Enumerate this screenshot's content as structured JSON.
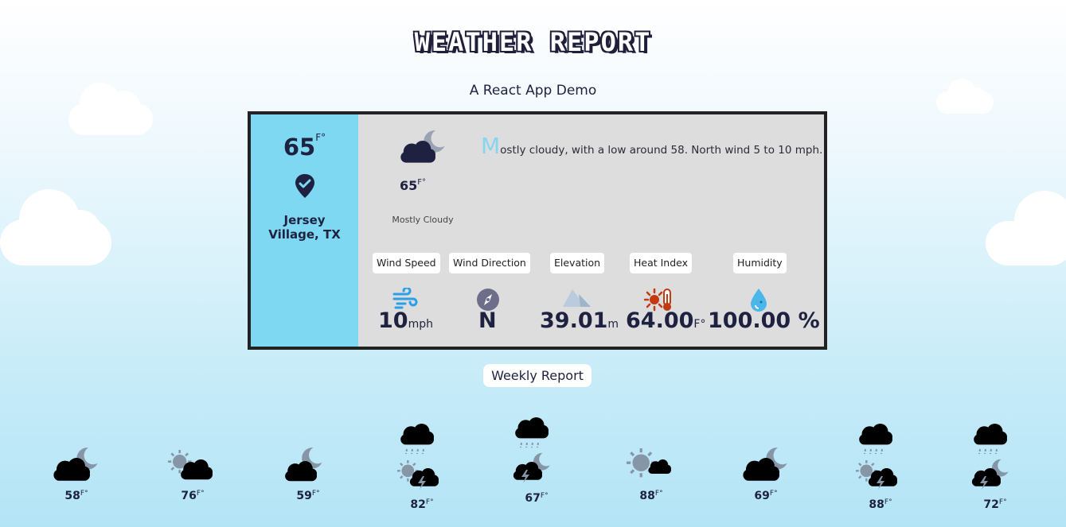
{
  "title": "WEATHER REPORT",
  "subtitle": "A React App Demo",
  "colors": {
    "panel": "#7fd8f2",
    "card": "#dddddd",
    "accent": "#86d6ef",
    "navy": "#1e2140"
  },
  "current": {
    "location_temp": "65",
    "unit": "F°",
    "location": "Jersey Village, TX",
    "icon": "partly-cloudy-night-icon",
    "temp": "65",
    "condition": "Mostly Cloudy",
    "forecast_first": "M",
    "forecast_rest": "ostly cloudy, with a low around 58. North wind 5 to 10 mph."
  },
  "stats": {
    "wind_speed": {
      "label": "Wind Speed",
      "value": "10",
      "unit": "mph",
      "icon": "wind-icon"
    },
    "wind_direction": {
      "label": "Wind Direction",
      "value": "N",
      "icon": "compass-icon"
    },
    "elevation": {
      "label": "Elevation",
      "value": "39.01",
      "unit": "m",
      "icon": "mountain-icon"
    },
    "heat_index": {
      "label": "Heat Index",
      "value": "64.00",
      "unit": "F°",
      "icon": "heat-index-icon"
    },
    "humidity": {
      "label": "Humidity",
      "value": "100.00 %",
      "icon": "humidity-icon"
    }
  },
  "weekly": {
    "label": "Weekly Report",
    "days": [
      {
        "temp": "58",
        "unit": "F°",
        "icon": "partly-cloudy-night-icon"
      },
      {
        "temp": "76",
        "unit": "F°",
        "icon": "partly-cloudy-day-icon"
      },
      {
        "temp": "59",
        "unit": "F°",
        "icon": "cloudy-night-icon"
      },
      {
        "temp": "82",
        "unit": "F°",
        "icon": "rain-thunderstorm-day-icon"
      },
      {
        "temp": "67",
        "unit": "F°",
        "icon": "rain-thunderstorm-night-icon"
      },
      {
        "temp": "88",
        "unit": "F°",
        "icon": "sun-cloud-icon"
      },
      {
        "temp": "69",
        "unit": "F°",
        "icon": "partly-cloudy-night-icon"
      },
      {
        "temp": "88",
        "unit": "F°",
        "icon": "rain-thunderstorm-day-icon"
      },
      {
        "temp": "72",
        "unit": "F°",
        "icon": "rain-thunderstorm-night-icon"
      }
    ]
  }
}
